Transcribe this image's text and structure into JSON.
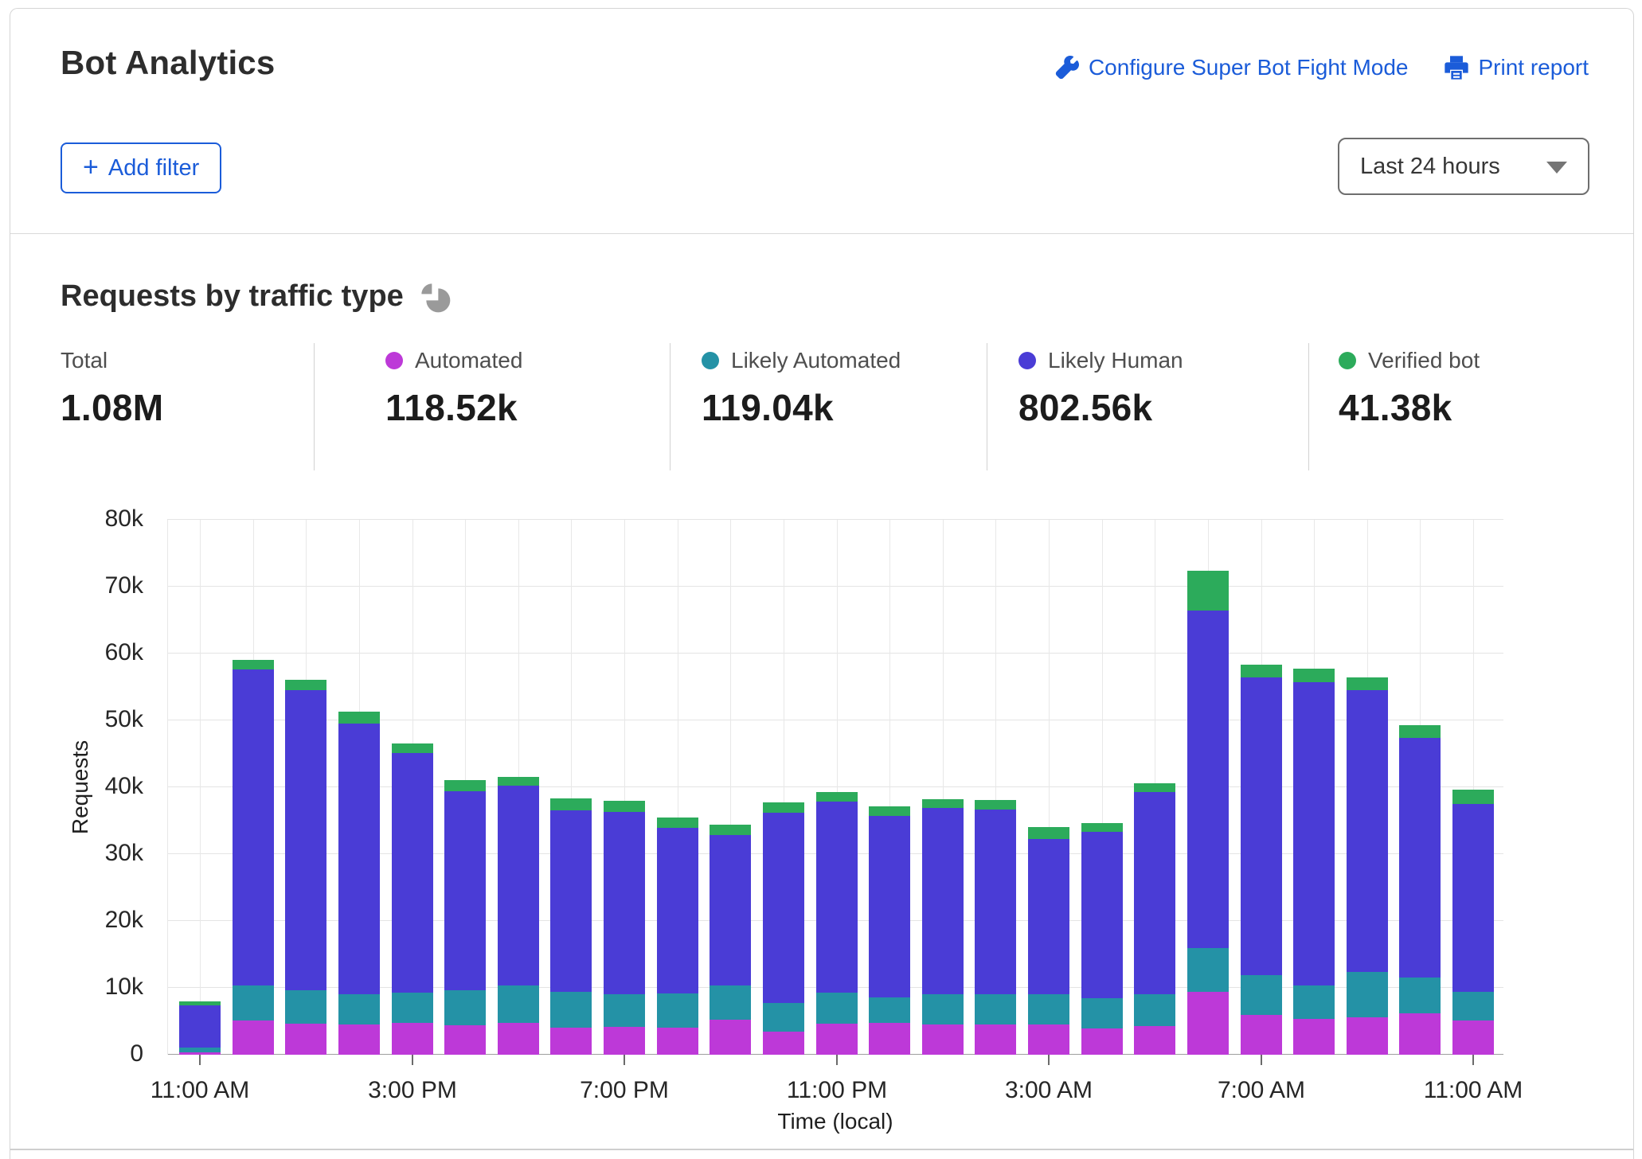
{
  "card": {
    "title": "Bot Analytics",
    "links": {
      "configure": "Configure Super Bot Fight Mode",
      "print": "Print report"
    },
    "add_filter": {
      "icon": "+",
      "label": "Add filter"
    },
    "time_range": "Last 24 hours"
  },
  "section": {
    "title": "Requests by traffic type"
  },
  "stats": {
    "items": [
      {
        "label": "Total",
        "value": "1.08M",
        "color": null
      },
      {
        "label": "Automated",
        "value": "118.52k",
        "color": "#bd39d8"
      },
      {
        "label": "Likely Automated",
        "value": "119.04k",
        "color": "#2492a6"
      },
      {
        "label": "Likely Human",
        "value": "802.56k",
        "color": "#4a3cd6"
      },
      {
        "label": "Verified bot",
        "value": "41.38k",
        "color": "#2cab5b"
      }
    ]
  },
  "chart_data": {
    "type": "bar",
    "stacked": true,
    "title": "Requests by traffic type",
    "xlabel": "Time (local)",
    "ylabel": "Requests",
    "ylim": [
      0,
      80000
    ],
    "grid": true,
    "value_unit": "thousands of requests (k)",
    "y_tick_labels": [
      "0",
      "10k",
      "20k",
      "30k",
      "40k",
      "50k",
      "60k",
      "70k",
      "80k"
    ],
    "x": [
      "11:00 AM",
      "12:00 PM",
      "1:00 PM",
      "2:00 PM",
      "3:00 PM",
      "4:00 PM",
      "5:00 PM",
      "6:00 PM",
      "7:00 PM",
      "8:00 PM",
      "9:00 PM",
      "10:00 PM",
      "11:00 PM",
      "12:00 AM",
      "1:00 AM",
      "2:00 AM",
      "3:00 AM",
      "4:00 AM",
      "5:00 AM",
      "6:00 AM",
      "7:00 AM",
      "8:00 AM",
      "9:00 AM",
      "10:00 AM",
      "11:00 AM"
    ],
    "x_tick_every": 4,
    "series": [
      {
        "name": "Automated",
        "color": "#bd39d8",
        "values": [
          0.4,
          5.1,
          4.7,
          4.5,
          4.8,
          4.4,
          4.8,
          4.1,
          4.2,
          4.1,
          5.2,
          3.4,
          4.7,
          4.8,
          4.5,
          4.5,
          4.5,
          3.9,
          4.3,
          9.4,
          5.9,
          5.4,
          5.6,
          6.2,
          5.1
        ]
      },
      {
        "name": "Likely Automated",
        "color": "#2492a6",
        "values": [
          0.7,
          5.3,
          5.0,
          4.6,
          4.5,
          5.3,
          5.6,
          5.3,
          4.8,
          5.1,
          5.2,
          4.3,
          4.6,
          3.8,
          4.5,
          4.5,
          4.5,
          4.5,
          4.8,
          6.5,
          6.0,
          5.0,
          6.8,
          5.3,
          4.3
        ]
      },
      {
        "name": "Likely Human",
        "color": "#4a3cd6",
        "values": [
          6.3,
          47.2,
          44.8,
          40.4,
          35.8,
          29.7,
          29.8,
          27.2,
          27.3,
          24.7,
          22.5,
          28.5,
          28.6,
          27.1,
          27.9,
          27.7,
          23.3,
          24.9,
          30.2,
          50.5,
          44.5,
          45.3,
          42.1,
          35.9,
          28.1
        ]
      },
      {
        "name": "Verified bot",
        "color": "#2cab5b",
        "values": [
          0.6,
          1.5,
          1.6,
          1.8,
          1.4,
          1.7,
          1.4,
          1.7,
          1.7,
          1.6,
          1.5,
          1.5,
          1.4,
          1.4,
          1.3,
          1.4,
          1.8,
          1.4,
          1.3,
          6.0,
          1.9,
          2.1,
          1.9,
          1.9,
          2.2
        ]
      }
    ],
    "legend_totals": {
      "Total": "1.08M",
      "Automated": "118.52k",
      "Likely Automated": "119.04k",
      "Likely Human": "802.56k",
      "Verified bot": "41.38k"
    },
    "legend_position": "top"
  }
}
